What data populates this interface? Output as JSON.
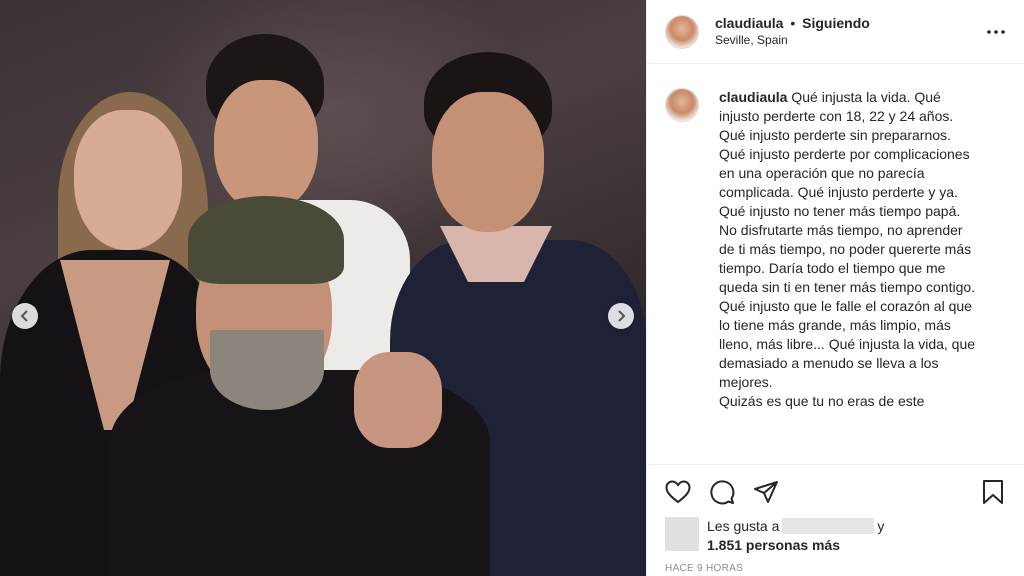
{
  "header": {
    "username": "claudiaula",
    "separator": "•",
    "follow_status": "Siguiendo",
    "location": "Seville, Spain",
    "more_icon": "more-horizontal-icon"
  },
  "caption": {
    "username": "claudiaula",
    "text": "Qué injusta la vida. Qué injusto perderte con 18, 22 y 24 años. Qué injusto perderte sin prepararnos. Qué injusto perderte por complicaciones en una operación que no parecía complicada. Qué injusto perderte y ya.\nQué injusto no tener más tiempo papá. No disfrutarte más tiempo, no aprender de ti más tiempo, no poder quererte más tiempo. Daría todo el tiempo que me queda sin ti en tener más tiempo contigo.\nQué injusto que le falle el corazón al que lo tiene más grande, más limpio, más lleno, más libre... Qué injusta la vida, que demasiado a menudo se lleva a los mejores.\nQuizás es que tu no eras de este"
  },
  "actions": {
    "like_icon": "heart-icon",
    "comment_icon": "comment-icon",
    "share_icon": "share-icon",
    "save_icon": "bookmark-icon"
  },
  "likes": {
    "prefix": "Les gusta a",
    "suffix": "y",
    "count": "1.851 personas más"
  },
  "timestamp": "HACE 9 HORAS",
  "media": {
    "prev_icon": "chevron-left-icon",
    "next_icon": "chevron-right-icon"
  }
}
